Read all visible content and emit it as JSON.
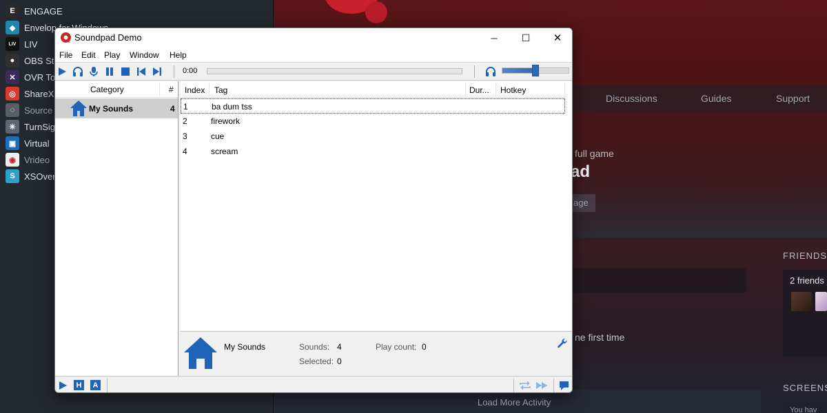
{
  "background": {
    "library_items": [
      {
        "label": "ENGAGE",
        "icon": "engage-icon",
        "color": "#2a2a2a",
        "glyph": "E"
      },
      {
        "label": "Envelop for Windows",
        "icon": "envelop-icon",
        "color": "#1e88a8",
        "glyph": "◆"
      },
      {
        "label": "LIV",
        "icon": "liv-icon",
        "color": "#111111",
        "glyph": "LIV"
      },
      {
        "label": "OBS St",
        "icon": "obs-icon",
        "color": "#303030",
        "glyph": "●"
      },
      {
        "label": "OVR To",
        "icon": "ovr-toolkit-icon",
        "color": "#3b2a5a",
        "glyph": "✕"
      },
      {
        "label": "ShareX",
        "icon": "sharex-icon",
        "color": "#d83b2b",
        "glyph": "◎"
      },
      {
        "label": "Source",
        "icon": "source-icon",
        "color": "#5a5f66",
        "glyph": "◌"
      },
      {
        "label": "TurnSig",
        "icon": "turnsig-icon",
        "color": "#5f6670",
        "glyph": "✳"
      },
      {
        "label": "Virtual",
        "icon": "virtual-desktop-icon",
        "color": "#1f6fb8",
        "glyph": "▣"
      },
      {
        "label": "Vrideo",
        "icon": "vrideo-icon",
        "color": "#eeeeee",
        "glyph": "◉"
      },
      {
        "label": "XSOver",
        "icon": "xsoverlay-icon",
        "color": "#2fa1c9",
        "glyph": "S"
      }
    ],
    "tabs": [
      "Discussions",
      "Guides",
      "Support"
    ],
    "full_game_text": "full game",
    "headline_fragment": "ad",
    "button_fragment": "age",
    "first_time_text": "ne first time",
    "friends_title": "FRIENDS",
    "friends_count": "2 friends",
    "load_more": "Load More Activity",
    "screenshots_title": "SCREENS",
    "screenshots_sub": "You hav"
  },
  "window": {
    "title": "Soundpad Demo",
    "controls": {
      "minimize": "─",
      "maximize": "☐",
      "close": "✕"
    },
    "menu": [
      "File",
      "Edit",
      "Play",
      "Window",
      "Help"
    ],
    "toolbar": {
      "time": "0:00",
      "volume_level": 0.5
    },
    "categories": {
      "header_label": "Category",
      "header_count": "#",
      "items": [
        {
          "label": "My Sounds",
          "count": "4"
        }
      ]
    },
    "sound_list": {
      "columns": [
        "Index",
        "Tag",
        "Dur...",
        "Hotkey"
      ],
      "rows": [
        {
          "index": "1",
          "tag": "ba dum tss"
        },
        {
          "index": "2",
          "tag": "firework"
        },
        {
          "index": "3",
          "tag": "cue"
        },
        {
          "index": "4",
          "tag": "scream"
        }
      ]
    },
    "info": {
      "name": "My Sounds",
      "sounds_label": "Sounds:",
      "sounds_value": "4",
      "selected_label": "Selected:",
      "selected_value": "0",
      "play_count_label": "Play count:",
      "play_count_value": "0"
    },
    "statusbar": {
      "hotkey_badge": "H",
      "auto_badge": "A"
    }
  },
  "colors": {
    "accent": "#1f64b8",
    "app_red": "#c62828"
  }
}
